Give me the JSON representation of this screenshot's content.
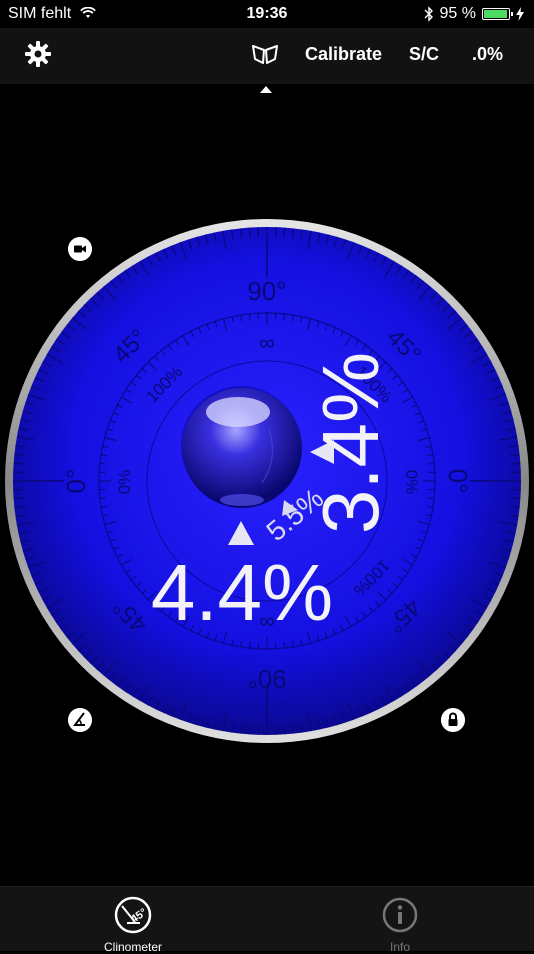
{
  "status": {
    "carrier": "SIM fehlt",
    "time": "19:36",
    "battery": "95 %",
    "battery_level": 0.95
  },
  "toolbar": {
    "calibrate_label": "Calibrate",
    "mode_label": "S/C",
    "precision_label": ".0%"
  },
  "dial": {
    "scale_top": "90°",
    "scale_bottom": "90°",
    "scale_left": "0°",
    "scale_right": "0°",
    "scale_45_tl": "45°",
    "scale_45_tr": "45°",
    "scale_45_br": "45°",
    "scale_45_bl": "45°",
    "inf_top": "∞",
    "inf_bottom": "∞",
    "pct100_tl": "100%",
    "pct100_tr": "100%",
    "pct100_br": "100%",
    "pct0_left": "0%",
    "pct0_right": "0%",
    "reading_x": "4.4%",
    "reading_y": "3.4%",
    "reading_combined": "5.5%",
    "colors": {
      "face": "#1410e0",
      "bezel": "#c8c8c8"
    }
  },
  "tabs": [
    {
      "label": "Clinometer",
      "icon": "clinometer-45-icon",
      "active": true
    },
    {
      "label": "Info",
      "icon": "info-icon",
      "active": false
    }
  ]
}
